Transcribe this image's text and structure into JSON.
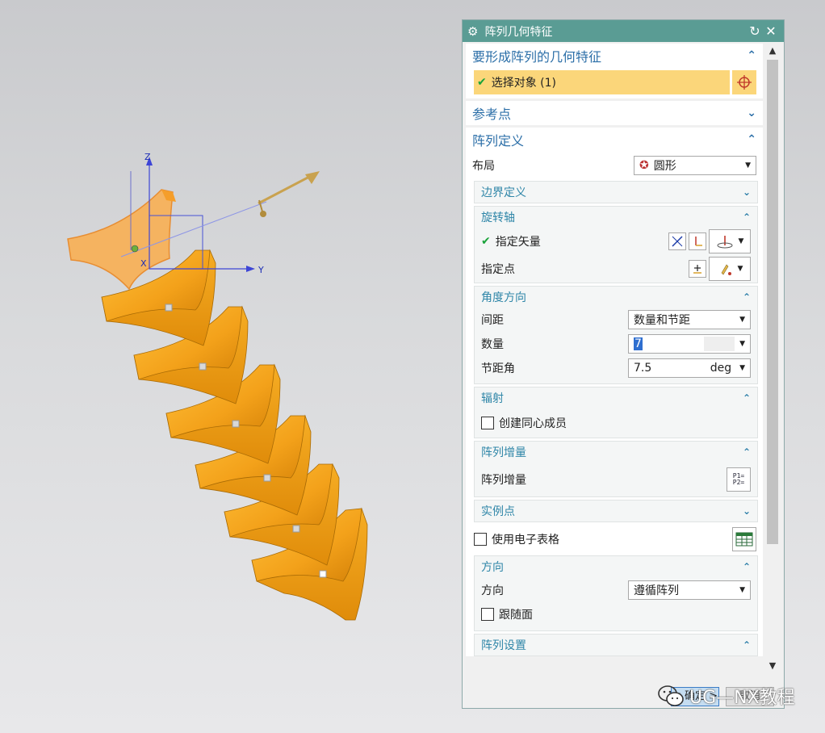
{
  "dialog": {
    "title": "阵列几何特征",
    "sections": {
      "geom": {
        "header": "要形成阵列的几何特征",
        "select_label": "选择对象 (1)"
      },
      "ref": {
        "header": "参考点"
      },
      "def": {
        "header": "阵列定义",
        "layout_label": "布局",
        "layout_value": "圆形",
        "boundary": {
          "header": "边界定义"
        },
        "axis": {
          "header": "旋转轴",
          "vector_label": "指定矢量",
          "point_label": "指定点"
        },
        "angle": {
          "header": "角度方向",
          "spacing_label": "间距",
          "spacing_value": "数量和节距",
          "count_label": "数量",
          "count_value": "7",
          "pitch_label": "节距角",
          "pitch_value": "7.5",
          "pitch_unit": "deg"
        },
        "radial": {
          "header": "辐射",
          "concentric_label": "创建同心成员"
        },
        "increment": {
          "header": "阵列增量",
          "label": "阵列增量",
          "icon_text1": "P1=",
          "icon_text2": "P2="
        }
      },
      "instance": {
        "header": "实例点"
      },
      "spreadsheet_label": "使用电子表格",
      "orientation": {
        "header": "方向",
        "label": "方向",
        "value": "遵循阵列",
        "follow_face_label": "跟随面"
      },
      "settings": {
        "header": "阵列设置"
      }
    },
    "buttons": {
      "ok": "< 确定 >",
      "cancel": "取消"
    }
  },
  "viewport": {
    "axis_z": "Z",
    "axis_y": "Y",
    "axis_x": "X"
  },
  "watermark": {
    "text": "UG—NX教程"
  },
  "colors": {
    "title_bar": "#5a9c94",
    "section_header": "#2c6fa8",
    "highlight": "#fbd67a",
    "part": "#f3a41c"
  }
}
